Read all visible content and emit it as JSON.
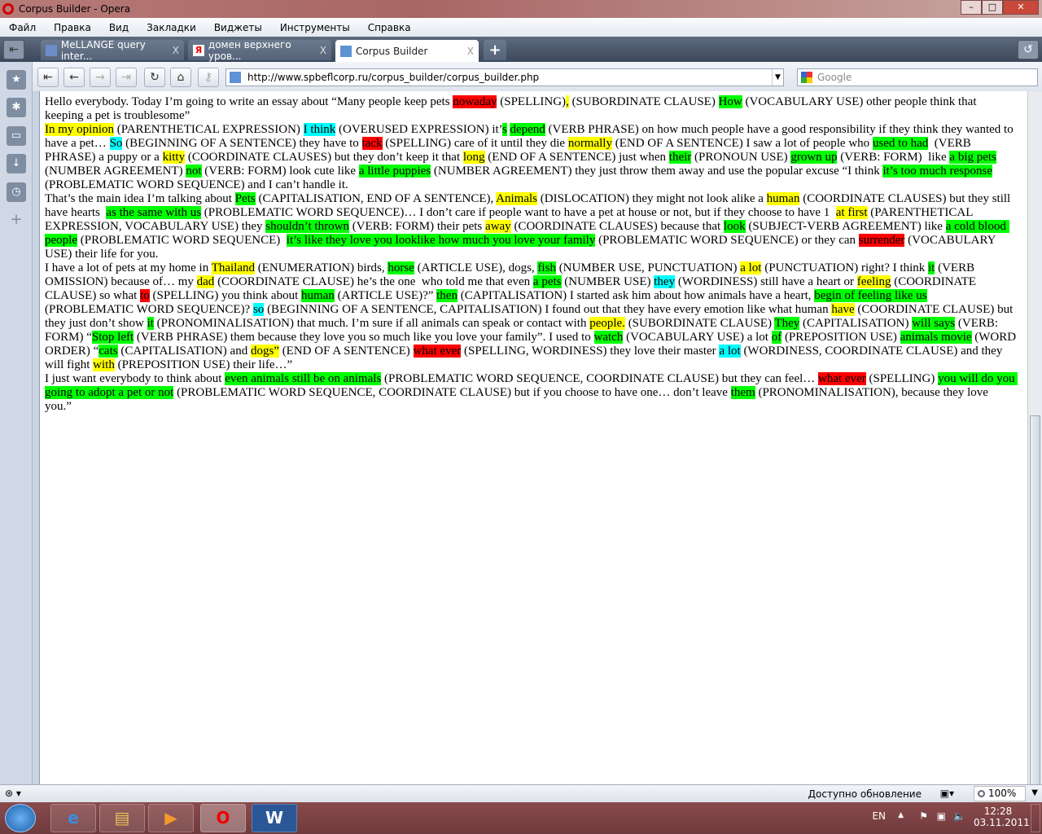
{
  "window": {
    "title": "Corpus Builder - Opera"
  },
  "menu": [
    "Файл",
    "Правка",
    "Вид",
    "Закладки",
    "Виджеты",
    "Инструменты",
    "Справка"
  ],
  "tabs": [
    {
      "label": "MeLLANGE query inter...",
      "close": "X"
    },
    {
      "label": "домен верхнего уров...",
      "close": "X"
    },
    {
      "label": "Corpus Builder",
      "close": "X"
    }
  ],
  "new_tab": "+",
  "address": {
    "url": "http://www.spbeflcorp.ru/corpus_builder/corpus_builder.php"
  },
  "search": {
    "placeholder": "Google"
  },
  "colors": {
    "r": "#ff0000",
    "y": "#ffff00",
    "g": "#00ff00",
    "c": "#00ffff"
  },
  "essay": [
    [
      [
        "Hello everybody. Today I’m going to write an essay about “Many people keep pets ",
        ""
      ],
      [
        "nowaday",
        "r"
      ],
      [
        " (SPELLING)",
        ""
      ],
      [
        ",",
        "y"
      ],
      [
        " (SUBORDINATE CLAUSE) ",
        ""
      ],
      [
        "How",
        "g"
      ],
      [
        " (VOCABULARY USE) other people think that keeping a pet is troublesome”",
        ""
      ]
    ],
    [
      [
        "In my opinion",
        "y"
      ],
      [
        " (PARENTHETICAL EXPRESSION) ",
        ""
      ],
      [
        "I think",
        "c"
      ],
      [
        " (OVERUSED EXPRESSION) it’",
        ""
      ],
      [
        "s",
        "g"
      ],
      [
        " ",
        ""
      ],
      [
        "depend",
        "g"
      ],
      [
        " (VERB PHRASE) on how much people have a good responsibility if they think they wanted to have a pet… ",
        ""
      ],
      [
        "So",
        "c"
      ],
      [
        " (BEGINNING OF A SENTENCE) they have to ",
        ""
      ],
      [
        "tack",
        "r"
      ],
      [
        " (SPELLING) care of it until they die ",
        ""
      ],
      [
        "normally",
        "y"
      ],
      [
        " (END OF A SENTENCE) I saw a lot of people who ",
        ""
      ],
      [
        "used to had",
        "g"
      ],
      [
        "  (VERB PHRASE) a puppy or a ",
        ""
      ],
      [
        "kitty",
        "y"
      ],
      [
        " (COORDINATE CLAUSES) but they don’t keep it that ",
        ""
      ],
      [
        "long",
        "y"
      ],
      [
        " (END OF A SENTENCE) just when ",
        ""
      ],
      [
        "their",
        "g"
      ],
      [
        " (PRONOUN USE) ",
        ""
      ],
      [
        "grown up",
        "g"
      ],
      [
        " (VERB: FORM)  like ",
        ""
      ],
      [
        "a big pets",
        "g"
      ],
      [
        " (NUMBER AGREEMENT) ",
        ""
      ],
      [
        "not",
        "g"
      ],
      [
        " (VERB: FORM) look cute like ",
        ""
      ],
      [
        "a little puppies",
        "g"
      ],
      [
        " (NUMBER AGREEMENT) they just throw them away and use the popular excuse “I think ",
        ""
      ],
      [
        "it’s too much response",
        "g"
      ],
      [
        " (PROBLEMATIC WORD SEQUENCE) and I can’t handle it.",
        ""
      ]
    ],
    [
      [
        "That’s the main idea I’m talking about ",
        ""
      ],
      [
        "Pets",
        "g"
      ],
      [
        " (CAPITALISATION, END OF A SENTENCE), ",
        ""
      ],
      [
        "Animals",
        "y"
      ],
      [
        " (DISLOCATION) they might not look alike a ",
        ""
      ],
      [
        "human",
        "y"
      ],
      [
        " (COORDINATE CLAUSES) but they still have hearts  ",
        ""
      ],
      [
        "as the same with us",
        "g"
      ],
      [
        " (PROBLEMATIC WORD SEQUENCE)… I don’t care if people want to have a pet at house or not, but if they choose to have 1  ",
        ""
      ],
      [
        "at first",
        "y"
      ],
      [
        " (PARENTHETICAL EXPRESSION, VOCABULARY USE) they ",
        ""
      ],
      [
        "shouldn’t thrown",
        "g"
      ],
      [
        " (VERB: FORM) their pets ",
        ""
      ],
      [
        "away",
        "y"
      ],
      [
        " (COORDINATE CLAUSES) because that ",
        ""
      ],
      [
        "look",
        "g"
      ],
      [
        " (SUBJECT-VERB AGREEMENT) like ",
        ""
      ],
      [
        "a cold blood people",
        "g"
      ],
      [
        " (PROBLEMATIC WORD SEQUENCE)  ",
        ""
      ],
      [
        "it’s like they love you looklike how much you love your family",
        "g"
      ],
      [
        " (PROBLEMATIC WORD SEQUENCE) or they can ",
        ""
      ],
      [
        "surrender",
        "r"
      ],
      [
        " (VOCABULARY USE) their life for you.",
        ""
      ]
    ],
    [
      [
        "I have a lot of pets at my home in ",
        ""
      ],
      [
        "Thailand",
        "y"
      ],
      [
        " (ENUMERATION) birds, ",
        ""
      ],
      [
        "horse",
        "g"
      ],
      [
        " (ARTICLE USE), dogs, ",
        ""
      ],
      [
        "fish",
        "g"
      ],
      [
        " (NUMBER USE, PUNCTUATION) ",
        ""
      ],
      [
        "a lot",
        "y"
      ],
      [
        " (PUNCTUATION) right? I think ",
        ""
      ],
      [
        "it",
        "g"
      ],
      [
        " (VERB OMISSION) because of… my ",
        ""
      ],
      [
        "dad",
        "y"
      ],
      [
        " (COORDINATE CLAUSE) he’s the one  who told me that even ",
        ""
      ],
      [
        "a pets",
        "g"
      ],
      [
        " (NUMBER USE) ",
        ""
      ],
      [
        "they",
        "c"
      ],
      [
        " (WORDINESS) still have a heart or ",
        ""
      ],
      [
        "feeling",
        "y"
      ],
      [
        " (COORDINATE CLAUSE) so what ",
        ""
      ],
      [
        "to",
        "r"
      ],
      [
        " (SPELLING) you think about ",
        ""
      ],
      [
        "human",
        "g"
      ],
      [
        " (ARTICLE USE)?” ",
        ""
      ],
      [
        "then",
        "g"
      ],
      [
        " (CAPITALISATION) I started ask him about how animals have a heart, ",
        ""
      ],
      [
        "begin of feeling like us",
        "g"
      ],
      [
        " (PROBLEMATIC WORD SEQUENCE)? ",
        ""
      ],
      [
        "so",
        "c"
      ],
      [
        " (BEGINNING OF A SENTENCE, CAPITALISATION) I found out that they have every emotion like what human ",
        ""
      ],
      [
        "have",
        "y"
      ],
      [
        " (COORDINATE CLAUSE) but they just don’t show ",
        ""
      ],
      [
        "it",
        "g"
      ],
      [
        " (PRONOMINALISATION) that much. I’m sure if all animals can speak or contact with ",
        ""
      ],
      [
        "people.",
        "y"
      ],
      [
        " (SUBORDINATE CLAUSE) ",
        ""
      ],
      [
        "They",
        "g"
      ],
      [
        " (CAPITALISATION) ",
        ""
      ],
      [
        "will says",
        "g"
      ],
      [
        " (VERB: FORM) “",
        ""
      ],
      [
        "Stop left",
        "g"
      ],
      [
        " (VERB PHRASE) them because they love you so much like you love your family”. I used to ",
        ""
      ],
      [
        "watch",
        "g"
      ],
      [
        " (VOCABULARY USE) a lot ",
        ""
      ],
      [
        "of",
        "g"
      ],
      [
        " (PREPOSITION USE) ",
        ""
      ],
      [
        "animals movie",
        "g"
      ],
      [
        " (WORD ORDER) “",
        ""
      ],
      [
        "cats",
        "g"
      ],
      [
        " (CAPITALISATION) and ",
        ""
      ],
      [
        "dogs”",
        "y"
      ],
      [
        " (END OF A SENTENCE) ",
        ""
      ],
      [
        "what ever",
        "r"
      ],
      [
        " (SPELLING, WORDINESS) they love their master ",
        ""
      ],
      [
        "a lot",
        "c"
      ],
      [
        " (WORDINESS, COORDINATE CLAUSE) and they will fight ",
        ""
      ],
      [
        "with",
        "y"
      ],
      [
        " (PREPOSITION USE) their life…”",
        ""
      ]
    ],
    [
      [
        "I just want everybody to think about ",
        ""
      ],
      [
        "even animals still be on animals",
        "g"
      ],
      [
        " (PROBLEMATIC WORD SEQUENCE, COORDINATE CLAUSE) but they can feel… ",
        ""
      ],
      [
        "what ever",
        "r"
      ],
      [
        " (SPELLING) ",
        ""
      ],
      [
        "you will do you going to adopt a pet or not",
        "g"
      ],
      [
        " (PROBLEMATIC WORD SEQUENCE, COORDINATE CLAUSE) but if you choose to have one… don’t leave ",
        ""
      ],
      [
        "them",
        "g"
      ],
      [
        " (PRONOMINALISATION), because they love you.”",
        ""
      ]
    ]
  ],
  "status": {
    "update": "Доступно обновление",
    "zoom": "100%"
  },
  "tray": {
    "lang": "EN",
    "time": "12:28",
    "date": "03.11.2011"
  }
}
